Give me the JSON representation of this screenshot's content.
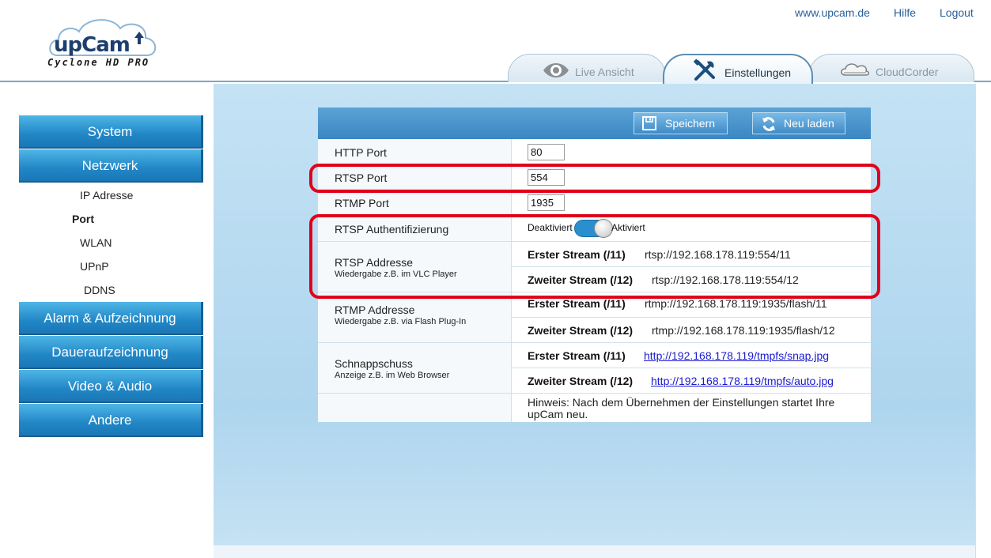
{
  "header": {
    "brand": "upCam",
    "model": "Cyclone HD PRO",
    "links": {
      "site": "www.upcam.de",
      "help": "Hilfe",
      "logout": "Logout"
    },
    "tabs": {
      "live": "Live Ansicht",
      "settings": "Einstellungen",
      "cloud": "CloudCorder"
    }
  },
  "sidebar": {
    "system": "System",
    "network": "Netzwerk",
    "sub": {
      "ip": "IP Adresse",
      "port": "Port",
      "wlan": "WLAN",
      "upnp": "UPnP",
      "ddns": "DDNS"
    },
    "alarm": "Alarm & Aufzeichnung",
    "continuous": "Daueraufzeichnung",
    "video": "Video & Audio",
    "other": "Andere"
  },
  "toolbar": {
    "save": "Speichern",
    "reload": "Neu laden"
  },
  "form": {
    "http_port": {
      "label": "HTTP Port",
      "value": "80"
    },
    "rtsp_port": {
      "label": "RTSP Port",
      "value": "554"
    },
    "rtmp_port": {
      "label": "RTMP Port",
      "value": "1935"
    },
    "rtsp_auth": {
      "label": "RTSP Authentifizierung",
      "off": "Deaktiviert",
      "on": "Aktiviert",
      "state": "on"
    },
    "rtsp_address": {
      "label": "RTSP Addresse",
      "sub": "Wiedergabe z.B. im VLC Player",
      "first_name": "Erster Stream (/11)",
      "first_url": "rtsp://192.168.178.119:554/11",
      "second_name": "Zweiter Stream (/12)",
      "second_url": "rtsp://192.168.178.119:554/12"
    },
    "rtmp_address": {
      "label": "RTMP Addresse",
      "sub": "Wiedergabe z.B. via Flash Plug-In",
      "first_name": "Erster Stream (/11)",
      "first_url": "rtmp://192.168.178.119:1935/flash/11",
      "second_name": "Zweiter Stream (/12)",
      "second_url": "rtmp://192.168.178.119:1935/flash/12"
    },
    "snapshot": {
      "label": "Schnappschuss",
      "sub": "Anzeige z.B. im Web Browser",
      "first_name": "Erster Stream (/11)",
      "first_url": "http://192.168.178.119/tmpfs/snap.jpg",
      "second_name": "Zweiter Stream (/12)",
      "second_url": "http://192.168.178.119/tmpfs/auto.jpg"
    },
    "hint": "Hinweis: Nach dem Übernehmen der Einstellungen startet Ihre upCam neu."
  },
  "colors": {
    "accent": "#2186c6",
    "highlight": "#e0001b",
    "link": "#1a1ad0"
  },
  "icons": {
    "live": "eye-icon",
    "settings": "tools-icon",
    "cloud": "cloud-icon",
    "save": "floppy-disk-icon",
    "reload": "refresh-icon"
  }
}
